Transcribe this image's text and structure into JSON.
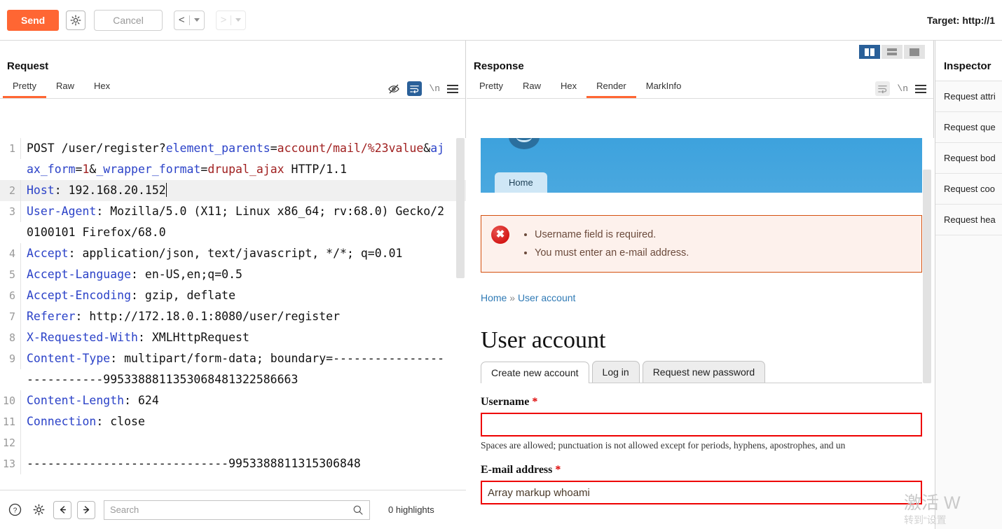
{
  "toolbar": {
    "send_label": "Send",
    "cancel_label": "Cancel",
    "gear_icon": "gear-icon",
    "back_icon": "chevron-left-icon",
    "forward_icon": "chevron-right-icon",
    "target_label": "Target: http://1",
    "accent_color": "#ff6633"
  },
  "request": {
    "title": "Request",
    "tabs": [
      {
        "label": "Pretty",
        "active": true
      },
      {
        "label": "Raw",
        "active": false
      },
      {
        "label": "Hex",
        "active": false
      }
    ],
    "icons": [
      "eye-slash-icon",
      "word-wrap-icon",
      "newline-icon",
      "hamburger-menu-icon"
    ],
    "lines": [
      {
        "number": "1",
        "highlight": false,
        "parts": [
          {
            "text": "POST /user/register?",
            "kind": "method"
          },
          {
            "text": "element_parents",
            "kind": "name"
          },
          {
            "text": "=",
            "kind": "plain"
          },
          {
            "text": "account/mail/%23value",
            "kind": "value"
          },
          {
            "text": "&",
            "kind": "plain"
          },
          {
            "text": "ajax_form",
            "kind": "name"
          },
          {
            "text": "=",
            "kind": "plain"
          },
          {
            "text": "1",
            "kind": "value"
          },
          {
            "text": "&",
            "kind": "plain"
          },
          {
            "text": "_wrapper_format",
            "kind": "name"
          },
          {
            "text": "=",
            "kind": "plain"
          },
          {
            "text": "drupal_ajax",
            "kind": "value"
          },
          {
            "text": " HTTP/1.1",
            "kind": "plain"
          }
        ]
      },
      {
        "number": "2",
        "highlight": true,
        "parts": [
          {
            "text": "Host",
            "kind": "name"
          },
          {
            "text": ": 192.168.20.152",
            "kind": "plain"
          },
          {
            "text": "",
            "kind": "caret"
          }
        ]
      },
      {
        "number": "3",
        "highlight": false,
        "parts": [
          {
            "text": "User-Agent",
            "kind": "name"
          },
          {
            "text": ": Mozilla/5.0 (X11; Linux x86_64; rv:68.0) Gecko/20100101 Firefox/68.0",
            "kind": "plain"
          }
        ]
      },
      {
        "number": "4",
        "highlight": false,
        "parts": [
          {
            "text": "Accept",
            "kind": "name"
          },
          {
            "text": ": application/json, text/javascript, */*; q=0.01",
            "kind": "plain"
          }
        ]
      },
      {
        "number": "5",
        "highlight": false,
        "parts": [
          {
            "text": "Accept-Language",
            "kind": "name"
          },
          {
            "text": ": en-US,en;q=0.5",
            "kind": "plain"
          }
        ]
      },
      {
        "number": "6",
        "highlight": false,
        "parts": [
          {
            "text": "Accept-Encoding",
            "kind": "name"
          },
          {
            "text": ": gzip, deflate",
            "kind": "plain"
          }
        ]
      },
      {
        "number": "7",
        "highlight": false,
        "parts": [
          {
            "text": "Referer",
            "kind": "name"
          },
          {
            "text": ": http://172.18.0.1:8080/user/register",
            "kind": "plain"
          }
        ]
      },
      {
        "number": "8",
        "highlight": false,
        "parts": [
          {
            "text": "X-Requested-With",
            "kind": "name"
          },
          {
            "text": ": XMLHttpRequest",
            "kind": "plain"
          }
        ]
      },
      {
        "number": "9",
        "highlight": false,
        "parts": [
          {
            "text": "Content-Type",
            "kind": "name"
          },
          {
            "text": ": multipart/form-data; boundary=---------------------------9953388811353068481322586663",
            "kind": "plain"
          }
        ]
      },
      {
        "number": "10",
        "highlight": false,
        "parts": [
          {
            "text": "Content-Length",
            "kind": "name"
          },
          {
            "text": ": 624",
            "kind": "plain"
          }
        ]
      },
      {
        "number": "11",
        "highlight": false,
        "parts": [
          {
            "text": "Connection",
            "kind": "name"
          },
          {
            "text": ": close",
            "kind": "plain"
          }
        ]
      },
      {
        "number": "12",
        "highlight": false,
        "parts": [
          {
            "text": "",
            "kind": "plain"
          }
        ]
      },
      {
        "number": "13",
        "highlight": false,
        "parts": [
          {
            "text": "-----------------------------9953388811315306848",
            "kind": "plain"
          }
        ]
      }
    ],
    "search": {
      "placeholder": "Search",
      "value": "",
      "highlights_label": "0 highlights",
      "help_icon": "help-circle-icon",
      "settings_icon": "gear-icon",
      "prev_icon": "arrow-left-icon",
      "next_icon": "arrow-right-icon",
      "search_icon": "search-icon"
    }
  },
  "response": {
    "title": "Response",
    "tabs": [
      {
        "label": "Pretty",
        "active": false
      },
      {
        "label": "Raw",
        "active": false
      },
      {
        "label": "Hex",
        "active": false
      },
      {
        "label": "Render",
        "active": true
      },
      {
        "label": "MarkInfo",
        "active": false
      }
    ],
    "icons": [
      "word-wrap-icon",
      "newline-icon",
      "hamburger-menu-icon"
    ],
    "layout_toggles": [
      {
        "name": "vertical-split-layout",
        "active": true
      },
      {
        "name": "horizontal-split-layout",
        "active": false
      },
      {
        "name": "single-pane-layout",
        "active": false
      }
    ],
    "rendered": {
      "site_tab": "Home",
      "errors": [
        "Username field is required.",
        "You must enter an e-mail address."
      ],
      "breadcrumb_home": "Home",
      "breadcrumb_sep": "»",
      "breadcrumb_current": "User account",
      "heading": "User account",
      "tabs": [
        {
          "label": "Create new account",
          "active": true
        },
        {
          "label": "Log in",
          "active": false
        },
        {
          "label": "Request new password",
          "active": false
        }
      ],
      "fields": [
        {
          "label": "Username",
          "required": "*",
          "value": "",
          "description": "Spaces are allowed; punctuation is not allowed except for periods, hyphens, apostrophes, and un"
        },
        {
          "label": "E-mail address",
          "required": "*",
          "value": "Array markup whoami",
          "description": ""
        }
      ]
    }
  },
  "inspector": {
    "title": "Inspector",
    "items": [
      "Request attri",
      "Request que",
      "Request bod",
      "Request coo",
      "Request hea"
    ]
  },
  "watermark": {
    "line1": "激活 W",
    "line2": "转到“设置"
  }
}
